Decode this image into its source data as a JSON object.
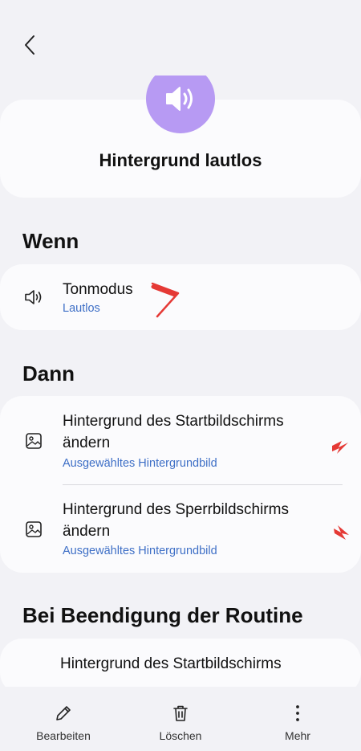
{
  "nav": {
    "back_label": ""
  },
  "routine": {
    "title": "Hintergrund lautlos",
    "icon": "speaker-icon",
    "icon_color": "#b79af3"
  },
  "if_section": {
    "heading": "Wenn",
    "items": [
      {
        "title": "Tonmodus",
        "subtitle": "Lautlos",
        "icon": "speaker-outline-icon"
      }
    ]
  },
  "then_section": {
    "heading": "Dann",
    "items": [
      {
        "title_line1": "Hintergrund des Startbildschirms",
        "title_line2": "ändern",
        "subtitle": "Ausgewähltes Hintergrundbild",
        "icon": "image-icon"
      },
      {
        "title_line1": "Hintergrund des Sperrbildschirms",
        "title_line2": "ändern",
        "subtitle": "Ausgewähltes Hintergrundbild",
        "icon": "image-icon"
      }
    ]
  },
  "end_section": {
    "heading": "Bei Beendigung der Routine",
    "items": [
      {
        "title_line1": "Hintergrund des Startbildschirms"
      }
    ]
  },
  "bottom_bar": {
    "edit_label": "Bearbeiten",
    "delete_label": "Löschen",
    "more_label": "Mehr"
  },
  "colors": {
    "accent_blue": "#3e6fc6",
    "marker_red": "#e53935",
    "background": "#f2f2f6",
    "card": "#fbfbfd"
  }
}
